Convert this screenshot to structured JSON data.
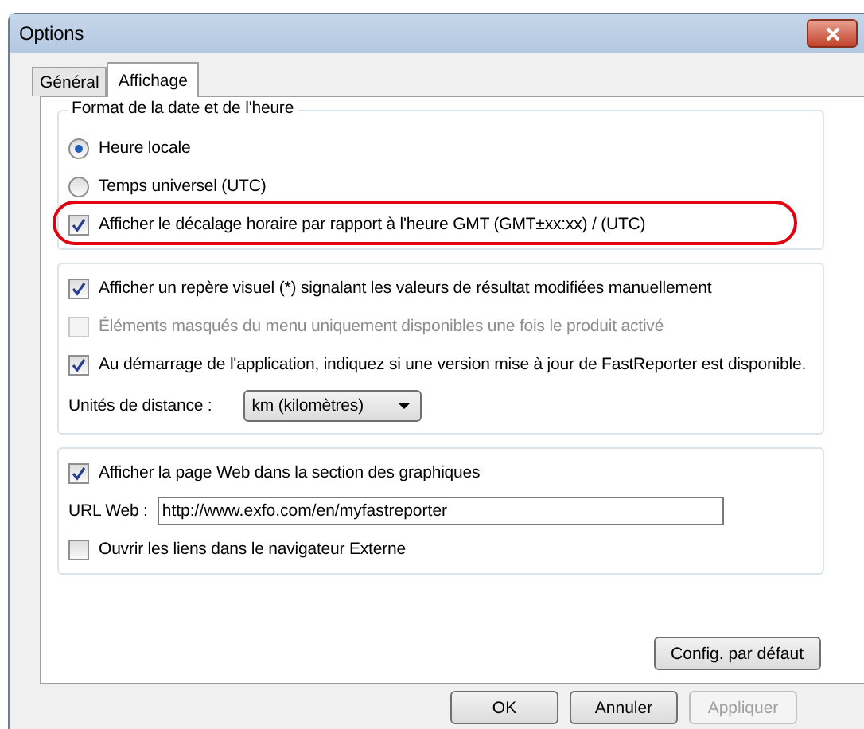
{
  "window": {
    "title": "Options"
  },
  "tabs": [
    {
      "label": "Général",
      "selected": false
    },
    {
      "label": "Affichage",
      "selected": true
    }
  ],
  "groups": [
    {
      "title": "Format de la date et de l'heure",
      "items": [
        {
          "kind": "radio",
          "label": "Heure locale",
          "selected": true,
          "disabled": false
        },
        {
          "kind": "radio",
          "label": "Temps universel (UTC)",
          "selected": false,
          "disabled": false
        },
        {
          "kind": "checkbox",
          "label": "Afficher le décalage horaire par rapport à l'heure GMT (GMT±xx:xx) / (UTC)",
          "checked": true,
          "disabled": false,
          "highlighted": true
        }
      ]
    },
    {
      "items": [
        {
          "kind": "checkbox",
          "label": "Afficher un repère visuel (*) signalant les valeurs de résultat modifiées manuellement",
          "checked": true,
          "disabled": false,
          "highlighted": false
        },
        {
          "kind": "checkbox",
          "label": "Éléments masqués du menu uniquement disponibles une fois le produit activé",
          "checked": false,
          "disabled": true,
          "highlighted": false
        },
        {
          "kind": "checkbox",
          "label": "Au démarrage de l'application, indiquez si une version mise à jour de FastReporter est disponible.",
          "checked": true,
          "disabled": false,
          "highlighted": false
        },
        {
          "kind": "dropdown",
          "label": "Unités de distance :",
          "value": "km (kilomètres)"
        }
      ]
    },
    {
      "items": [
        {
          "kind": "checkbox",
          "label": "Afficher la page Web dans la section des graphiques",
          "checked": true,
          "disabled": false,
          "highlighted": false
        },
        {
          "kind": "textfield",
          "label": "URL Web :",
          "value": "http://www.exfo.com/en/myfastreporter"
        },
        {
          "kind": "checkbox",
          "label": "Ouvrir les liens dans le navigateur Externe",
          "checked": false,
          "disabled": false,
          "highlighted": false
        }
      ]
    }
  ],
  "defaults_button": "Config. par défaut",
  "buttons": [
    {
      "label": "OK",
      "disabled": false
    },
    {
      "label": "Annuler",
      "disabled": false
    },
    {
      "label": "Appliquer",
      "disabled": true
    }
  ]
}
